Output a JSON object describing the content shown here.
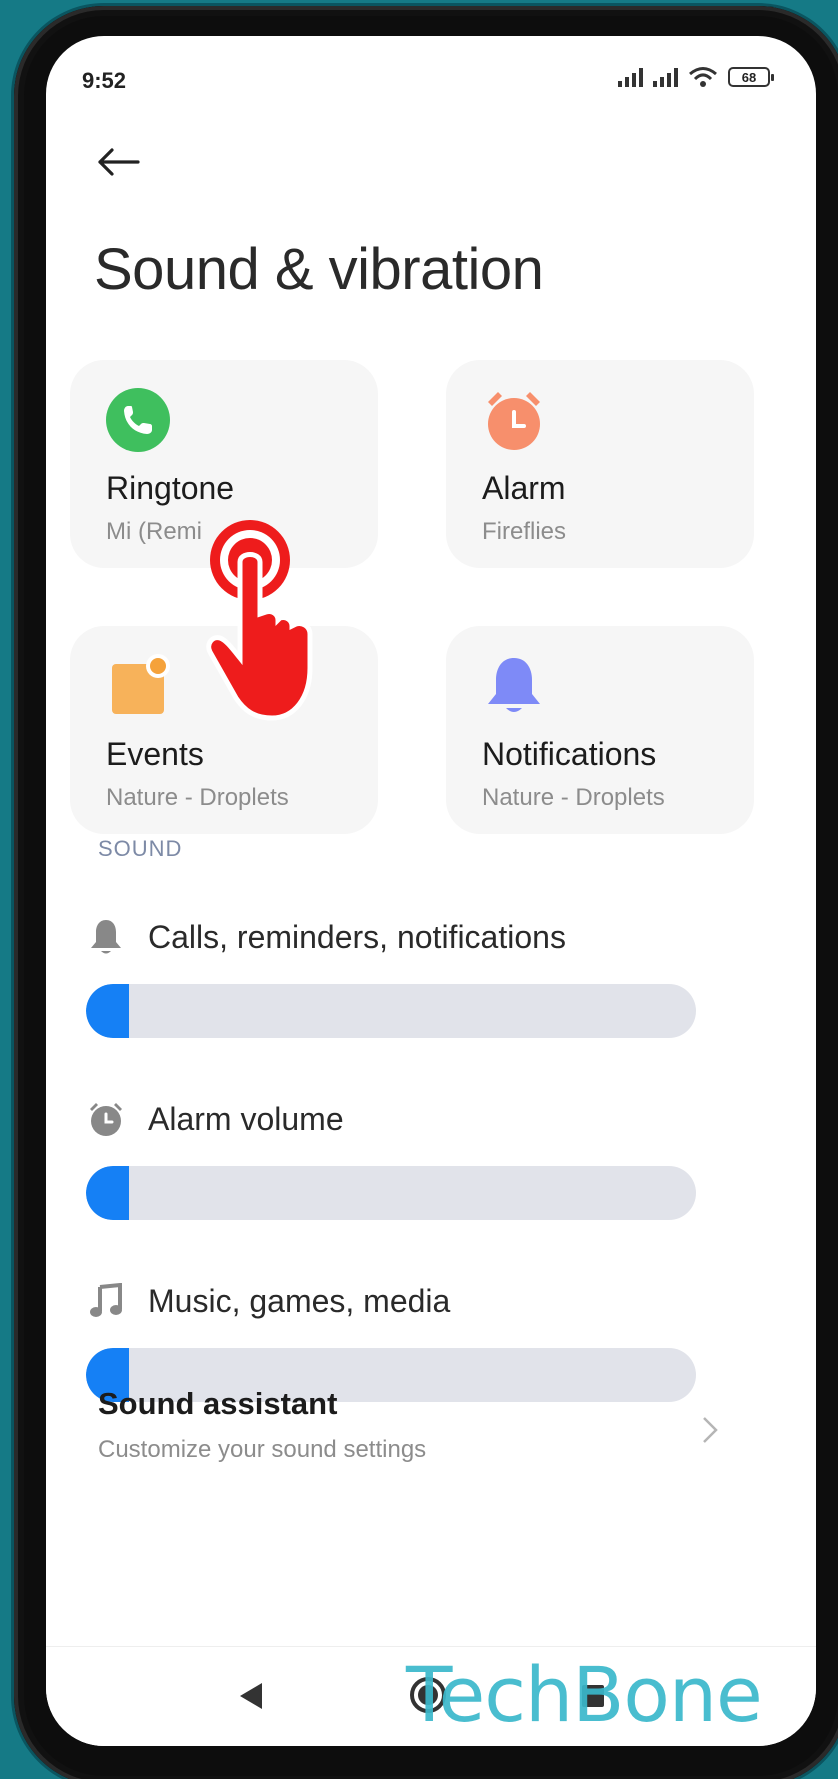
{
  "status_bar": {
    "time": "9:52",
    "battery": "68"
  },
  "page": {
    "title": "Sound & vibration"
  },
  "tiles": [
    {
      "title": "Ringtone",
      "subtitle": "Mi (Remi",
      "icon": "phone-icon",
      "color": "#3fbf5e"
    },
    {
      "title": "Alarm",
      "subtitle": "Fireflies",
      "icon": "alarm-clock-icon",
      "color": "#f78f6c"
    },
    {
      "title": "Events",
      "subtitle": "Nature - Droplets",
      "icon": "calendar-event-icon",
      "color": "#f5a23b"
    },
    {
      "title": "Notifications",
      "subtitle": "Nature - Droplets",
      "icon": "bell-icon",
      "color": "#7e8af7"
    }
  ],
  "sound_section": {
    "header": "SOUND",
    "sliders": [
      {
        "label": "Calls, reminders, notifications",
        "icon": "bell-icon",
        "level": 0.07
      },
      {
        "label": "Alarm volume",
        "icon": "alarm-clock-icon",
        "level": 0.07
      },
      {
        "label": "Music, games, media",
        "icon": "music-note-icon",
        "level": 0.07
      }
    ]
  },
  "sound_assistant": {
    "title": "Sound assistant",
    "subtitle": "Customize your sound settings"
  },
  "watermark": "TechBone",
  "colors": {
    "accent": "#1580f5",
    "track": "#e1e3ea",
    "background": "#157a86",
    "tap_hand": "#ee1c1c"
  }
}
